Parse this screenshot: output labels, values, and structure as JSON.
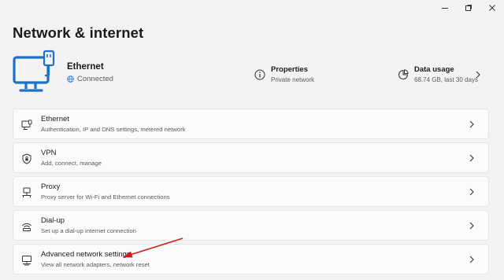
{
  "window": {
    "controls": [
      "minimize-icon",
      "maximize-icon",
      "close-icon"
    ]
  },
  "page": {
    "title": "Network & internet"
  },
  "summary": {
    "connection_name": "Ethernet",
    "connection_status": "Connected",
    "properties": {
      "title": "Properties",
      "subtitle": "Private network"
    },
    "data_usage": {
      "title": "Data usage",
      "subtitle": "68.74 GB, last 30 days"
    }
  },
  "items": [
    {
      "title": "Ethernet",
      "subtitle": "Authentication, IP and DNS settings, metered network",
      "icon": "ethernet-icon"
    },
    {
      "title": "VPN",
      "subtitle": "Add, connect, manage",
      "icon": "shield-icon"
    },
    {
      "title": "Proxy",
      "subtitle": "Proxy server for Wi-Fi and Ethernet connections",
      "icon": "proxy-icon"
    },
    {
      "title": "Dial-up",
      "subtitle": "Set up a dial-up internet connection",
      "icon": "dialup-icon"
    },
    {
      "title": "Advanced network settings",
      "subtitle": "View all network adapters, network reset",
      "icon": "network-adapter-icon"
    }
  ],
  "colors": {
    "accent": "#1a73c8",
    "annotation_arrow": "#d21e1e",
    "background": "#f3f3f3",
    "card": "#fbfbfb"
  }
}
